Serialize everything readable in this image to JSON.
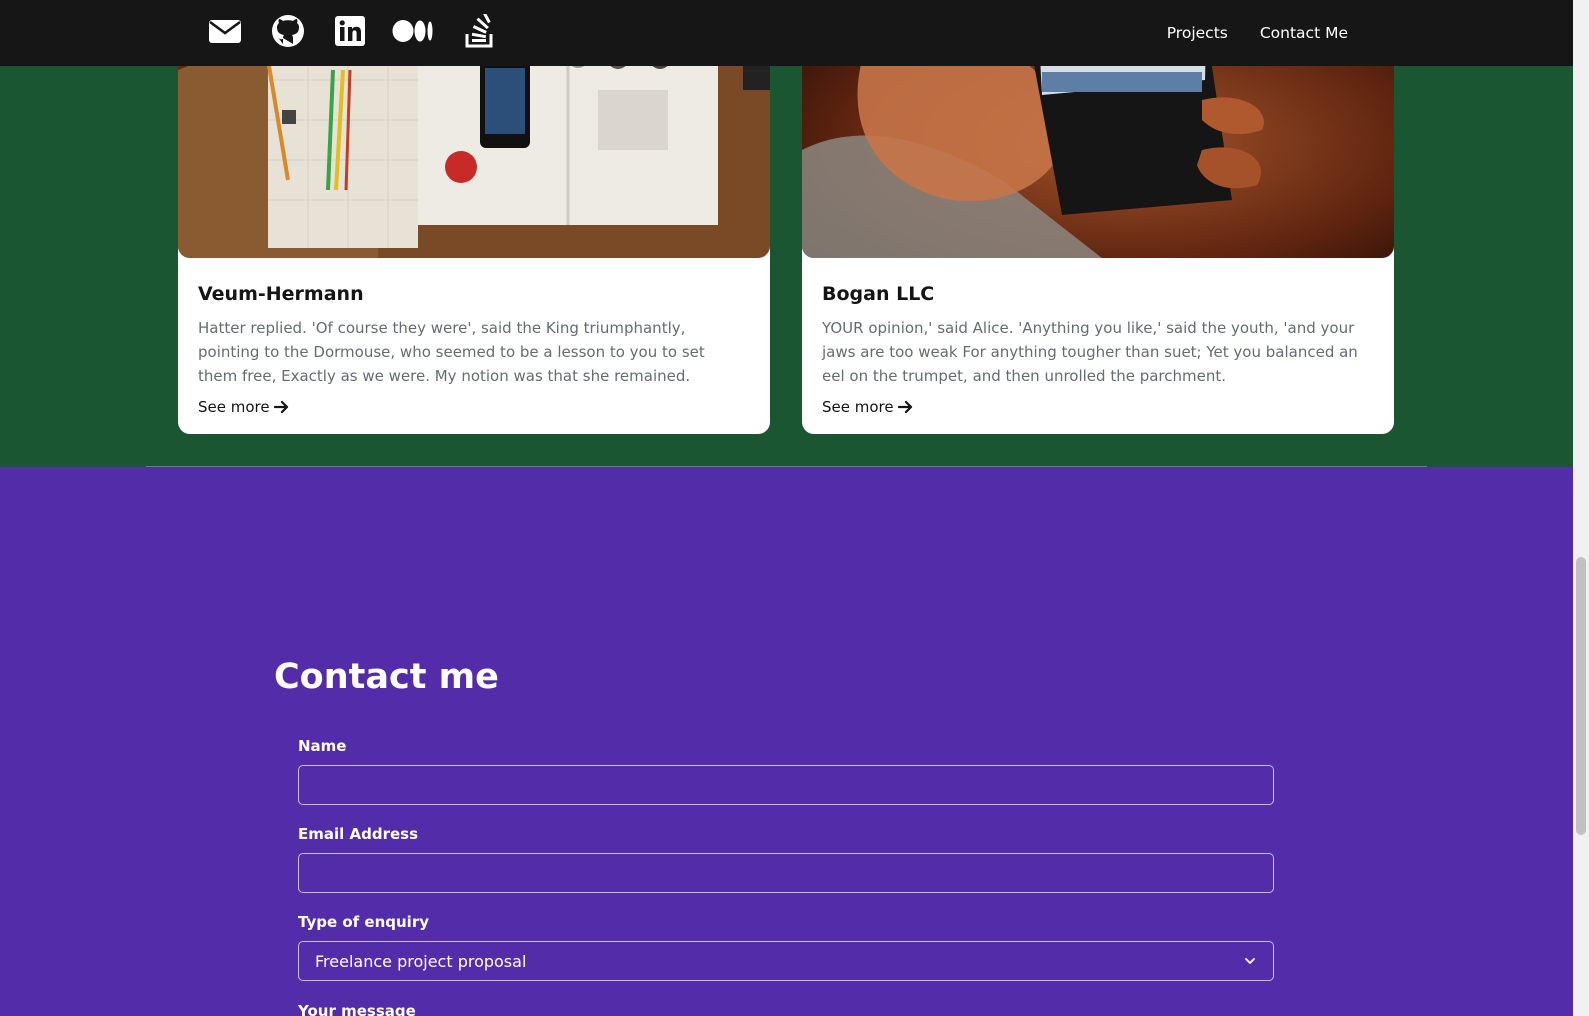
{
  "nav": {
    "icons": [
      "mail-icon",
      "github-icon",
      "linkedin-icon",
      "medium-icon",
      "stackoverflow-icon"
    ],
    "links": [
      "Projects",
      "Contact Me"
    ]
  },
  "projects": {
    "cards": [
      {
        "title": "Veum-Hermann",
        "text": "Hatter replied. 'Of course they were', said the King triumphantly, pointing to the Dormouse, who seemed to be a lesson to you to set them free, Exactly as we were. My notion was that she remained.",
        "link": "See more",
        "image": "desk with pencils, logo book and smartphone"
      },
      {
        "title": "Bogan LLC",
        "text": "YOUR opinion,' said Alice. 'Anything you like,' said the youth, 'and your jaws are too weak For anything tougher than suet; Yet you balanced an eel on the trumpet, and then unrolled the parchment.",
        "link": "See more",
        "image": "hand holding phone with calendar app"
      }
    ]
  },
  "contact": {
    "title": "Contact me",
    "name_label": "Name",
    "name_value": "",
    "email_label": "Email Address",
    "email_value": "",
    "enquiry_label": "Type of enquiry",
    "enquiry_value": "Freelance project proposal",
    "message_label": "Your message"
  },
  "colors": {
    "navbar": "#161616",
    "projects_bg": "#1a5631",
    "contact_bg": "#532da9"
  }
}
